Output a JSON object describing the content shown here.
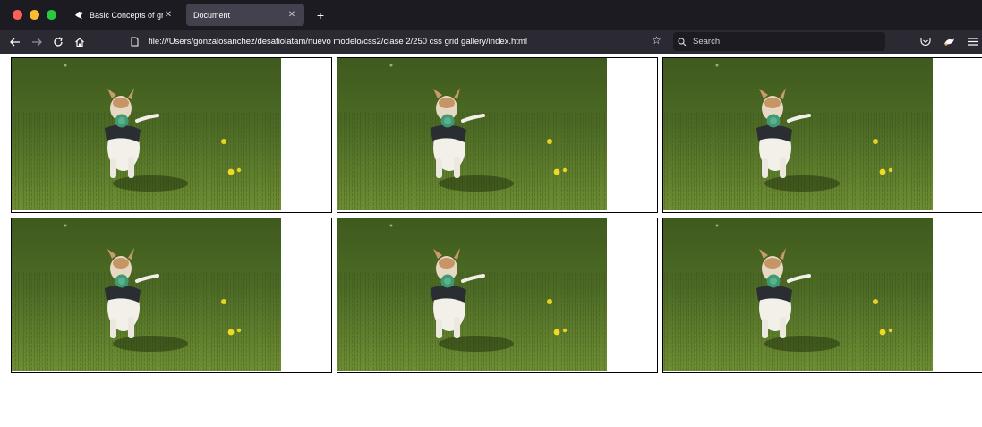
{
  "browser": {
    "tabs": [
      {
        "title": "Basic Concepts of grid layout - ",
        "favicon": "mdn-icon",
        "active": false
      },
      {
        "title": "Document",
        "favicon": "",
        "active": true
      }
    ],
    "address": "file:///Users/gonzalosanchez/desafiolatam/nuevo modelo/css2/clase 2/250 css grid gallery/index.html",
    "search_placeholder": "Search",
    "nav_icons": [
      "back-icon",
      "forward-icon",
      "reload-icon",
      "home-icon"
    ],
    "toolbar_icons": [
      "pocket-icon",
      "extension-icon",
      "menu-icon"
    ]
  },
  "gallery": {
    "columns": 3,
    "items": [
      {
        "subject": "dog-running-on-grass"
      },
      {
        "subject": "dog-running-on-grass"
      },
      {
        "subject": "dog-running-on-grass"
      },
      {
        "subject": "dog-running-on-grass"
      },
      {
        "subject": "dog-running-on-grass"
      },
      {
        "subject": "dog-running-on-grass"
      }
    ]
  },
  "colors": {
    "chrome_dark": "#1c1b22",
    "chrome_nav": "#2b2a33",
    "tab_active": "#42414d",
    "grass_dark": "#3f5a1e",
    "grass_light": "#6f8f34",
    "card_border": "#000000"
  }
}
